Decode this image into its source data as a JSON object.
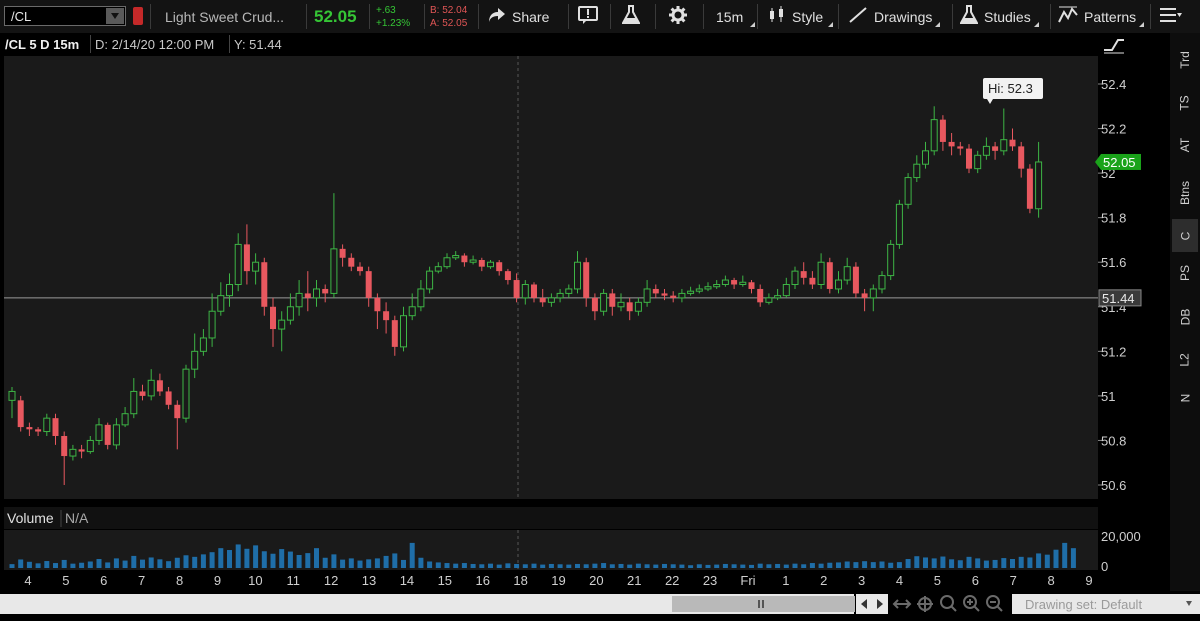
{
  "toolbar": {
    "symbol": "/CL",
    "description": "Light Sweet Crud...",
    "last": "52.05",
    "change": "+.63",
    "change_pct": "+1.23%",
    "bid": "B: 52.04",
    "ask": "A: 52.05",
    "share_label": "Share",
    "timeframe_label": "15m",
    "style_label": "Style",
    "drawings_label": "Drawings",
    "studies_label": "Studies",
    "patterns_label": "Patterns"
  },
  "chart_header": {
    "title": "/CL 5 D 15m",
    "date": "D: 2/14/20 12:00 PM",
    "y": "Y: 51.44"
  },
  "volume_header": {
    "label": "Volume",
    "value": "N/A"
  },
  "sidebar_tabs": [
    "Trd",
    "TS",
    "AT",
    "Btns",
    "C",
    "PS",
    "DB",
    "L2",
    "N"
  ],
  "sidebar_active": "C",
  "drawing_set_label": "Drawing set: Default",
  "colors": {
    "up": "#3db545",
    "down": "#e8585f",
    "volume": "#1f6ea8",
    "last_price_bg": "#1aa31a",
    "background": "#1a1a1a"
  },
  "chart_data": {
    "type": "candlestick",
    "ylim": [
      50.5,
      52.5
    ],
    "y_ticks": [
      "52.4",
      "52.2",
      "52",
      "51.8",
      "51.6",
      "51.4",
      "51.2",
      "51",
      "50.8",
      "50.6"
    ],
    "x_ticks": [
      "4",
      "5",
      "6",
      "7",
      "8",
      "9",
      "10",
      "11",
      "12",
      "13",
      "14",
      "15",
      "16",
      "18",
      "19",
      "20",
      "21",
      "22",
      "23",
      "Fri",
      "1",
      "2",
      "3",
      "4",
      "5",
      "6",
      "7",
      "8",
      "9"
    ],
    "high_label": "Hi: 52.3",
    "last_price_label": "52.05",
    "crosshair_price_label": "51.44",
    "crosshair_price": 51.44,
    "volume_axis_label": "20,000",
    "volume_zero_label": "0",
    "volume_max": 20000,
    "candles": [
      [
        50.98,
        51.02,
        51.04,
        50.9
      ],
      [
        50.98,
        50.86,
        51.0,
        50.84
      ],
      [
        50.86,
        50.85,
        50.88,
        50.82
      ],
      [
        50.85,
        50.84,
        50.86,
        50.82
      ],
      [
        50.84,
        50.9,
        50.92,
        50.82
      ],
      [
        50.9,
        50.82,
        50.92,
        50.78
      ],
      [
        50.82,
        50.73,
        50.84,
        50.6
      ],
      [
        50.73,
        50.76,
        50.78,
        50.71
      ],
      [
        50.76,
        50.75,
        50.78,
        50.72
      ],
      [
        50.75,
        50.8,
        50.82,
        50.74
      ],
      [
        50.8,
        50.87,
        50.9,
        50.78
      ],
      [
        50.87,
        50.78,
        50.88,
        50.76
      ],
      [
        50.78,
        50.87,
        50.9,
        50.76
      ],
      [
        50.87,
        50.92,
        50.95,
        50.86
      ],
      [
        50.92,
        51.02,
        51.08,
        50.9
      ],
      [
        51.02,
        51.0,
        51.05,
        50.98
      ],
      [
        51.0,
        51.07,
        51.12,
        50.98
      ],
      [
        51.07,
        51.02,
        51.1,
        51.0
      ],
      [
        51.02,
        50.96,
        51.04,
        50.94
      ],
      [
        50.96,
        50.9,
        50.98,
        50.76
      ],
      [
        50.9,
        51.12,
        51.14,
        50.88
      ],
      [
        51.12,
        51.2,
        51.28,
        51.08
      ],
      [
        51.2,
        51.26,
        51.3,
        51.18
      ],
      [
        51.26,
        51.38,
        51.46,
        51.22
      ],
      [
        51.38,
        51.45,
        51.51,
        51.36
      ],
      [
        51.45,
        51.5,
        51.55,
        51.4
      ],
      [
        51.5,
        51.68,
        51.73,
        51.47
      ],
      [
        51.68,
        51.56,
        51.77,
        51.5
      ],
      [
        51.56,
        51.6,
        51.64,
        51.5
      ],
      [
        51.6,
        51.4,
        51.62,
        51.36
      ],
      [
        51.4,
        51.3,
        51.44,
        51.22
      ],
      [
        51.3,
        51.34,
        51.38,
        51.2
      ],
      [
        51.34,
        51.4,
        51.46,
        51.32
      ],
      [
        51.4,
        51.46,
        51.52,
        51.36
      ],
      [
        51.46,
        51.44,
        51.56,
        51.38
      ],
      [
        51.44,
        51.48,
        51.52,
        51.4
      ],
      [
        51.48,
        51.46,
        51.5,
        51.42
      ],
      [
        51.46,
        51.66,
        51.91,
        51.44
      ],
      [
        51.66,
        51.62,
        51.68,
        51.58
      ],
      [
        51.62,
        51.58,
        51.64,
        51.56
      ],
      [
        51.58,
        51.56,
        51.6,
        51.54
      ],
      [
        51.56,
        51.44,
        51.58,
        51.4
      ],
      [
        51.44,
        51.38,
        51.46,
        51.3
      ],
      [
        51.38,
        51.34,
        51.42,
        51.28
      ],
      [
        51.34,
        51.22,
        51.36,
        51.18
      ],
      [
        51.22,
        51.36,
        51.4,
        51.2
      ],
      [
        51.36,
        51.4,
        51.46,
        51.34
      ],
      [
        51.4,
        51.48,
        51.52,
        51.38
      ],
      [
        51.48,
        51.56,
        51.58,
        51.46
      ],
      [
        51.56,
        51.58,
        51.6,
        51.55
      ],
      [
        51.58,
        51.62,
        51.64,
        51.57
      ],
      [
        51.62,
        51.63,
        51.65,
        51.61
      ],
      [
        51.63,
        51.6,
        51.64,
        51.58
      ],
      [
        51.6,
        51.61,
        51.63,
        51.59
      ],
      [
        51.61,
        51.58,
        51.62,
        51.56
      ],
      [
        51.58,
        51.6,
        51.61,
        51.57
      ],
      [
        51.6,
        51.56,
        51.61,
        51.54
      ],
      [
        51.56,
        51.52,
        51.57,
        51.5
      ],
      [
        51.52,
        51.44,
        51.55,
        51.42
      ],
      [
        51.44,
        51.5,
        51.52,
        51.41
      ],
      [
        51.5,
        51.44,
        51.51,
        51.42
      ],
      [
        51.44,
        51.42,
        51.48,
        51.4
      ],
      [
        51.42,
        51.44,
        51.46,
        51.4
      ],
      [
        51.44,
        51.46,
        51.48,
        51.42
      ],
      [
        51.46,
        51.48,
        51.5,
        51.44
      ],
      [
        51.48,
        51.6,
        51.65,
        51.46
      ],
      [
        51.6,
        51.44,
        51.62,
        51.4
      ],
      [
        51.44,
        51.38,
        51.46,
        51.34
      ],
      [
        51.38,
        51.46,
        51.48,
        51.36
      ],
      [
        51.46,
        51.4,
        51.48,
        51.36
      ],
      [
        51.4,
        51.42,
        51.46,
        51.38
      ],
      [
        51.42,
        51.38,
        51.44,
        51.34
      ],
      [
        51.38,
        51.42,
        51.44,
        51.36
      ],
      [
        51.42,
        51.48,
        51.52,
        51.4
      ],
      [
        51.48,
        51.46,
        51.5,
        51.44
      ],
      [
        51.46,
        51.45,
        51.48,
        51.43
      ],
      [
        51.45,
        51.44,
        51.47,
        51.42
      ],
      [
        51.44,
        51.46,
        51.48,
        51.42
      ],
      [
        51.46,
        51.47,
        51.49,
        51.45
      ],
      [
        51.47,
        51.48,
        51.5,
        51.46
      ],
      [
        51.48,
        51.49,
        51.51,
        51.47
      ],
      [
        51.49,
        51.5,
        51.52,
        51.48
      ],
      [
        51.5,
        51.52,
        51.54,
        51.49
      ],
      [
        51.52,
        51.5,
        51.53,
        51.48
      ],
      [
        51.5,
        51.51,
        51.54,
        51.49
      ],
      [
        51.51,
        51.48,
        51.52,
        51.46
      ],
      [
        51.48,
        51.42,
        51.5,
        51.4
      ],
      [
        51.42,
        51.44,
        51.46,
        51.41
      ],
      [
        51.44,
        51.45,
        51.48,
        51.43
      ],
      [
        51.45,
        51.5,
        51.53,
        51.44
      ],
      [
        51.5,
        51.56,
        51.58,
        51.48
      ],
      [
        51.56,
        51.53,
        51.6,
        51.5
      ],
      [
        51.53,
        51.5,
        51.56,
        51.48
      ],
      [
        51.5,
        51.6,
        51.64,
        51.48
      ],
      [
        51.6,
        51.48,
        51.62,
        51.46
      ],
      [
        51.48,
        51.52,
        51.56,
        51.46
      ],
      [
        51.52,
        51.58,
        51.62,
        51.5
      ],
      [
        51.58,
        51.46,
        51.6,
        51.44
      ],
      [
        51.46,
        51.44,
        51.48,
        51.38
      ],
      [
        51.44,
        51.48,
        51.5,
        51.38
      ],
      [
        51.48,
        51.54,
        51.56,
        51.46
      ],
      [
        51.54,
        51.68,
        51.7,
        51.52
      ],
      [
        51.68,
        51.86,
        51.88,
        51.66
      ],
      [
        51.86,
        51.98,
        52.0,
        51.84
      ],
      [
        51.98,
        52.04,
        52.08,
        51.96
      ],
      [
        52.04,
        52.1,
        52.14,
        52.02
      ],
      [
        52.1,
        52.24,
        52.3,
        52.08
      ],
      [
        52.24,
        52.14,
        52.26,
        52.1
      ],
      [
        52.14,
        52.12,
        52.18,
        52.08
      ],
      [
        52.12,
        52.11,
        52.14,
        52.08
      ],
      [
        52.11,
        52.02,
        52.13,
        52.0
      ],
      [
        52.02,
        52.08,
        52.1,
        52.0
      ],
      [
        52.08,
        52.12,
        52.16,
        52.06
      ],
      [
        52.12,
        52.1,
        52.14,
        52.06
      ],
      [
        52.1,
        52.15,
        52.29,
        52.08
      ],
      [
        52.15,
        52.12,
        52.2,
        52.1
      ],
      [
        52.12,
        52.02,
        52.14,
        51.98
      ],
      [
        52.02,
        51.84,
        52.04,
        51.82
      ],
      [
        51.84,
        52.05,
        52.14,
        51.8
      ]
    ],
    "volumes": [
      2500,
      5500,
      4000,
      3000,
      4500,
      3200,
      5200,
      2800,
      3400,
      4200,
      5800,
      3600,
      6200,
      4800,
      7800,
      5400,
      6800,
      5600,
      4400,
      6600,
      8200,
      7200,
      8800,
      10200,
      12800,
      11600,
      15200,
      12400,
      14600,
      10800,
      9200,
      12200,
      10600,
      8400,
      9600,
      12800,
      6600,
      8800,
      5400,
      6200,
      4800,
      5600,
      6200,
      7800,
      9400,
      5200,
      16200,
      6600,
      4200,
      3600,
      3200,
      2800,
      3200,
      2600,
      2400,
      2800,
      2200,
      3000,
      2600,
      2400,
      2800,
      2200,
      2600,
      2400,
      2200,
      2600,
      2400,
      2800,
      3200,
      2400,
      2600,
      2200,
      2800,
      2400,
      2200,
      2600,
      2400,
      2200,
      1800,
      2400,
      2000,
      2200,
      2600,
      2400,
      2200,
      2000,
      2800,
      2400,
      2600,
      2200,
      2800,
      2400,
      3200,
      2800,
      3400,
      3600,
      4200,
      3800,
      4400,
      3800,
      4200,
      3400,
      3800,
      5800,
      7600,
      6800,
      6200,
      7400,
      5600,
      5000,
      7200,
      6200,
      4800,
      5200,
      6400,
      5800,
      7200,
      6800,
      9400,
      8600,
      11800,
      16200,
      12800
    ]
  }
}
